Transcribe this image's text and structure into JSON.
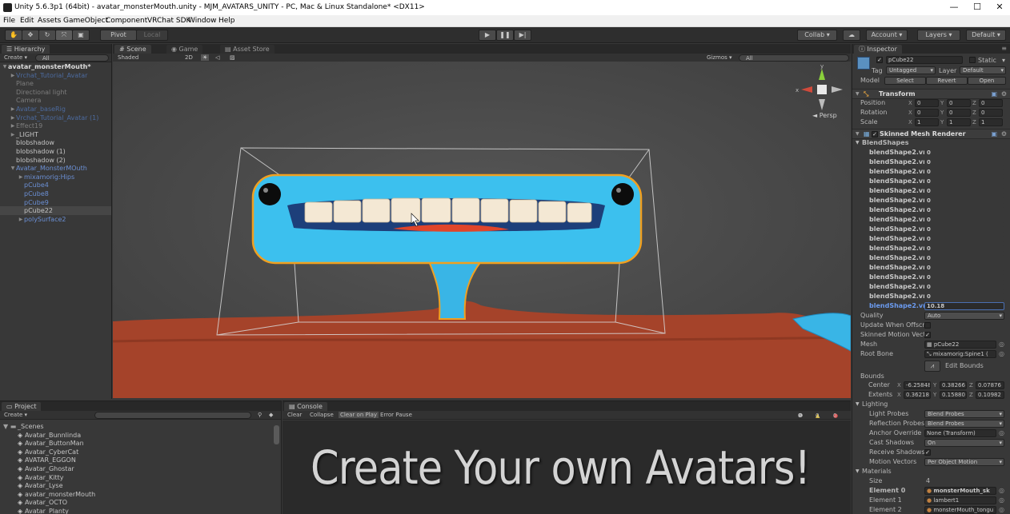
{
  "window": {
    "title": "Unity 5.6.3p1 (64bit) - avatar_monsterMouth.unity - MJM_AVATARS_UNITY - PC, Mac & Linux Standalone* <DX11>",
    "minimize": "—",
    "maximize": "☐",
    "close": "✕"
  },
  "menu": [
    "File",
    "Edit",
    "Assets",
    "GameObject",
    "Component",
    "VRChat SDK",
    "Window",
    "Help"
  ],
  "toolbar": {
    "pivot": "Pivot",
    "local": "Local",
    "collab": "Collab ▾",
    "account": "Account",
    "layers": "Layers",
    "layout": "Default"
  },
  "hierarchy": {
    "tab": "Hierarchy",
    "create": "Create ▾",
    "search": "All",
    "rows": [
      {
        "label": "avatar_monsterMouth*",
        "indent": 1,
        "style": "scene",
        "fold": "▼"
      },
      {
        "label": "Vrchat_Tutorial_Avatar",
        "indent": 2,
        "style": "prefab-dim",
        "fold": "▶"
      },
      {
        "label": "Plane",
        "indent": 2,
        "style": "grey",
        "fold": ""
      },
      {
        "label": "Directional light",
        "indent": 2,
        "style": "grey",
        "fold": ""
      },
      {
        "label": "Camera",
        "indent": 2,
        "style": "grey",
        "fold": ""
      },
      {
        "label": "Avatar_baseRig",
        "indent": 2,
        "style": "prefab-dim",
        "fold": "▶"
      },
      {
        "label": "Vrchat_Tutorial_Avatar (1)",
        "indent": 2,
        "style": "prefab-dim",
        "fold": "▶"
      },
      {
        "label": "Effect19",
        "indent": 2,
        "style": "grey",
        "fold": "▶"
      },
      {
        "label": "_LIGHT",
        "indent": 2,
        "style": "normal",
        "fold": "▶"
      },
      {
        "label": "blobshadow",
        "indent": 2,
        "style": "normal",
        "fold": ""
      },
      {
        "label": "blobshadow (1)",
        "indent": 2,
        "style": "normal",
        "fold": ""
      },
      {
        "label": "blobshadow (2)",
        "indent": 2,
        "style": "normal",
        "fold": ""
      },
      {
        "label": "Avatar_MonsterMOuth",
        "indent": 2,
        "style": "prefab",
        "fold": "▼"
      },
      {
        "label": "mixamorig:Hips",
        "indent": 3,
        "style": "prefab",
        "fold": "▶"
      },
      {
        "label": "pCube4",
        "indent": 3,
        "style": "prefab",
        "fold": ""
      },
      {
        "label": "pCube8",
        "indent": 3,
        "style": "prefab",
        "fold": ""
      },
      {
        "label": "pCube9",
        "indent": 3,
        "style": "prefab",
        "fold": ""
      },
      {
        "label": "pCube22",
        "indent": 3,
        "style": "normal",
        "fold": "",
        "selected": true
      },
      {
        "label": "polySurface2",
        "indent": 3,
        "style": "prefab",
        "fold": "▶"
      }
    ]
  },
  "scene": {
    "tabs": [
      "Scene",
      "Game",
      "Asset Store"
    ],
    "shading": "Shaded",
    "mode2d": "2D",
    "gizmos": "Gizmos ▾",
    "search": "All",
    "persp": "◄ Persp"
  },
  "project": {
    "tab": "Project",
    "create": "Create ▾",
    "rows": [
      {
        "label": "_Scenes",
        "folder": true
      },
      {
        "label": "Avatar_Bunnlinda"
      },
      {
        "label": "Avatar_ButtonMan"
      },
      {
        "label": "Avatar_CyberCat"
      },
      {
        "label": "AVATAR_EGGON"
      },
      {
        "label": "Avatar_Ghostar"
      },
      {
        "label": "Avatar_Kitty"
      },
      {
        "label": "Avatar_Lyse"
      },
      {
        "label": "avatar_monsterMouth"
      },
      {
        "label": "Avatar_OCTO"
      },
      {
        "label": "Avatar_Planty"
      }
    ]
  },
  "console": {
    "tab": "Console",
    "buttons": [
      "Clear",
      "Collapse",
      "Clear on Play",
      "Error Pause"
    ],
    "counts": [
      "0",
      "0",
      "0"
    ]
  },
  "overlay": "Create Your own Avatars!",
  "inspector": {
    "tab": "Inspector",
    "object_name": "pCube22",
    "static": "Static",
    "tag_label": "Tag",
    "tag": "Untagged",
    "layer_label": "Layer",
    "layer": "Default",
    "model_label": "Model",
    "model_buttons": [
      "Select",
      "Revert",
      "Open"
    ],
    "transform": {
      "title": "Transform",
      "rows": [
        {
          "label": "Position",
          "x": "0",
          "y": "0",
          "z": "0"
        },
        {
          "label": "Rotation",
          "x": "0",
          "y": "0",
          "z": "0"
        },
        {
          "label": "Scale",
          "x": "1",
          "y": "1",
          "z": "1"
        }
      ]
    },
    "skinned": {
      "title": "Skinned Mesh Renderer",
      "blendshapes_label": "BlendShapes",
      "blendshapes": [
        {
          "label": "blendShape2.vr",
          "value": "0"
        },
        {
          "label": "blendShape2.vr",
          "value": "0"
        },
        {
          "label": "blendShape2.vr",
          "value": "0"
        },
        {
          "label": "blendShape2.vr",
          "value": "0"
        },
        {
          "label": "blendShape2.vr",
          "value": "0"
        },
        {
          "label": "blendShape2.vr",
          "value": "0"
        },
        {
          "label": "blendShape2.vr",
          "value": "0"
        },
        {
          "label": "blendShape2.vr",
          "value": "0"
        },
        {
          "label": "blendShape2.vr",
          "value": "0"
        },
        {
          "label": "blendShape2.vr",
          "value": "0"
        },
        {
          "label": "blendShape2.vr",
          "value": "0"
        },
        {
          "label": "blendShape2.vr",
          "value": "0"
        },
        {
          "label": "blendShape2.vr",
          "value": "0"
        },
        {
          "label": "blendShape2.vr",
          "value": "0"
        },
        {
          "label": "blendShape2.vr",
          "value": "0"
        },
        {
          "label": "blendShape2.vr",
          "value": "0"
        },
        {
          "label": "blendShape2.vr",
          "value": "10.18",
          "active": true
        }
      ],
      "quality_label": "Quality",
      "quality": "Auto",
      "update_label": "Update When Offscre",
      "motion_label": "Skinned Motion Vect",
      "mesh_label": "Mesh",
      "mesh": "pCube22",
      "root_label": "Root Bone",
      "root": "mixamorig:Spine1 (",
      "edit_bounds": "Edit Bounds",
      "bounds_label": "Bounds",
      "center_label": "Center",
      "center": {
        "x": "-6.25848",
        "y": "0.38266",
        "z": "0.07876"
      },
      "extents_label": "Extents",
      "extents": {
        "x": "0.36218",
        "y": "0.15880",
        "z": "0.10982"
      }
    },
    "lighting": {
      "title": "Lighting",
      "rows": [
        {
          "label": "Light Probes",
          "value": "Blend Probes",
          "kind": "dropdown"
        },
        {
          "label": "Reflection Probes",
          "value": "Blend Probes",
          "kind": "dropdown"
        },
        {
          "label": "Anchor Override",
          "value": "None (Transform)",
          "kind": "field"
        },
        {
          "label": "Cast Shadows",
          "value": "On",
          "kind": "dropdown"
        },
        {
          "label": "Receive Shadows",
          "value": "✓",
          "kind": "check"
        },
        {
          "label": "Motion Vectors",
          "value": "Per Object Motion",
          "kind": "dropdown"
        }
      ]
    },
    "materials": {
      "title": "Materials",
      "rows": [
        {
          "label": "Size",
          "value": "4"
        },
        {
          "label": "Element 0",
          "value": "monsterMouth_sk",
          "bold": true
        },
        {
          "label": "Element 1",
          "value": "lambert1"
        },
        {
          "label": "Element 2",
          "value": "monsterMouth_tongu"
        }
      ]
    }
  }
}
